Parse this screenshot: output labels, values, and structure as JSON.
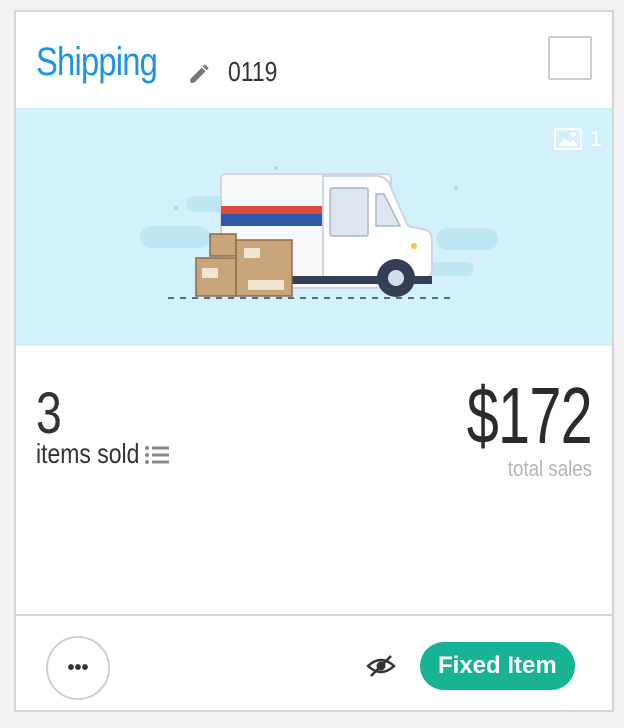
{
  "header": {
    "title": "Shipping",
    "code": "0119"
  },
  "image": {
    "count": "1"
  },
  "stats": {
    "items_sold_value": "3",
    "items_sold_label": "items sold",
    "total_sales_value": "$172",
    "total_sales_label": "total sales"
  },
  "footer": {
    "more_label": "•••",
    "badge_label": "Fixed Item"
  },
  "colors": {
    "title": "#1e93e0",
    "image_bg": "#d3f1fb",
    "badge_bg": "#17b394"
  },
  "icons": [
    "edit-icon",
    "image-icon",
    "list-icon",
    "more-icon",
    "hide-icon"
  ]
}
